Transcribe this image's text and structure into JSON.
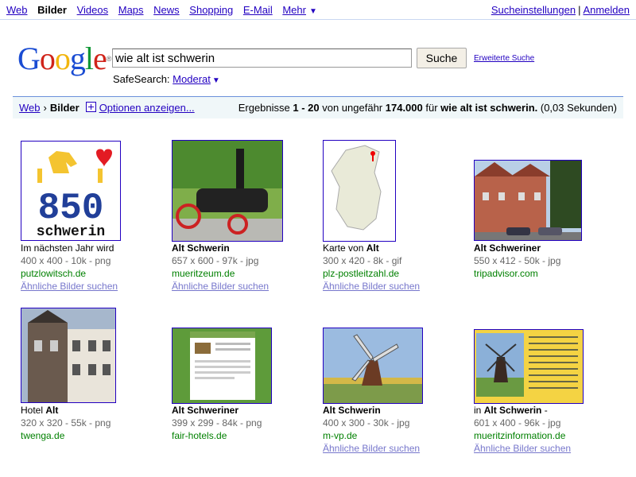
{
  "nav": {
    "left": [
      {
        "label": "Web",
        "current": false
      },
      {
        "label": "Bilder",
        "current": true
      },
      {
        "label": "Videos",
        "current": false
      },
      {
        "label": "Maps",
        "current": false
      },
      {
        "label": "News",
        "current": false
      },
      {
        "label": "Shopping",
        "current": false
      },
      {
        "label": "E-Mail",
        "current": false
      },
      {
        "label": "Mehr",
        "current": false
      }
    ],
    "more_caret": "▼",
    "right": [
      "Sucheinstellungen",
      "Anmelden"
    ],
    "separator": "|"
  },
  "logo": {
    "letters": [
      "G",
      "o",
      "o",
      "g",
      "l",
      "e"
    ],
    "colors": [
      "#1a4cd3",
      "#d0241a",
      "#f2b50e",
      "#1a4cd3",
      "#129737",
      "#d0241a"
    ],
    "sup": "®"
  },
  "search": {
    "query": "wie alt ist schwerin",
    "button": "Suche",
    "advanced": "Erweiterte Suche"
  },
  "safesearch": {
    "label": "SafeSearch:",
    "value": "Moderat",
    "caret": "▼"
  },
  "results_bar": {
    "crumb_web": "Web",
    "crumb_arrow": "›",
    "crumb_current": "Bilder",
    "options": "Optionen anzeigen...",
    "stats_prefix": "Ergebnisse ",
    "range": "1 - 20",
    "stats_mid1": " von ungefähr ",
    "total": "174.000",
    "stats_mid2": " für ",
    "query": "wie alt ist schwerin.",
    "time": " (0,03 Sekunden)"
  },
  "results": [
    {
      "title_parts": [
        {
          "t": "Im nächsten Jahr wird",
          "b": false
        }
      ],
      "dims": "400 x 400 - 10k - png",
      "domain": "putzlowitsch.de",
      "similar": "Ähnliche Bilder suchen",
      "thumb": "logo850",
      "thumb_text": [
        "850",
        "schwerin"
      ]
    },
    {
      "title_parts": [
        {
          "t": "Alt Schwerin",
          "b": true
        }
      ],
      "dims": "657 x 600 - 97k - jpg",
      "domain": "mueritzeum.de",
      "similar": "Ähnliche Bilder suchen",
      "thumb": "engine"
    },
    {
      "title_parts": [
        {
          "t": "Karte von ",
          "b": false
        },
        {
          "t": "Alt",
          "b": true
        }
      ],
      "dims": "300 x 420 - 8k - gif",
      "domain": "plz-postleitzahl.de",
      "similar": "Ähnliche Bilder suchen",
      "thumb": "map"
    },
    {
      "title_parts": [
        {
          "t": "Alt Schweriner",
          "b": true
        }
      ],
      "dims": "550 x 412 - 50k - jpg",
      "domain": "tripadvisor.com",
      "similar": "",
      "thumb": "houses"
    },
    {
      "title_parts": [
        {
          "t": "Hotel ",
          "b": false
        },
        {
          "t": "Alt",
          "b": true
        }
      ],
      "dims": "320 x 320 - 55k - png",
      "domain": "twenga.de",
      "similar": "",
      "thumb": "timber"
    },
    {
      "title_parts": [
        {
          "t": "Alt Schweriner",
          "b": true
        }
      ],
      "dims": "399 x 299 - 84k - png",
      "domain": "fair-hotels.de",
      "similar": "",
      "thumb": "website"
    },
    {
      "title_parts": [
        {
          "t": "Alt Schwerin",
          "b": true
        }
      ],
      "dims": "400 x 300 - 30k - jpg",
      "domain": "m-vp.de",
      "similar": "Ähnliche Bilder suchen",
      "thumb": "windmill"
    },
    {
      "title_parts": [
        {
          "t": "in ",
          "b": false
        },
        {
          "t": "Alt Schwerin",
          "b": true
        },
        {
          "t": " -",
          "b": false
        }
      ],
      "dims": "601 x 400 - 96k - jpg",
      "domain": "mueritzinformation.de",
      "similar": "Ähnliche Bilder suchen",
      "thumb": "mill_doc"
    }
  ]
}
